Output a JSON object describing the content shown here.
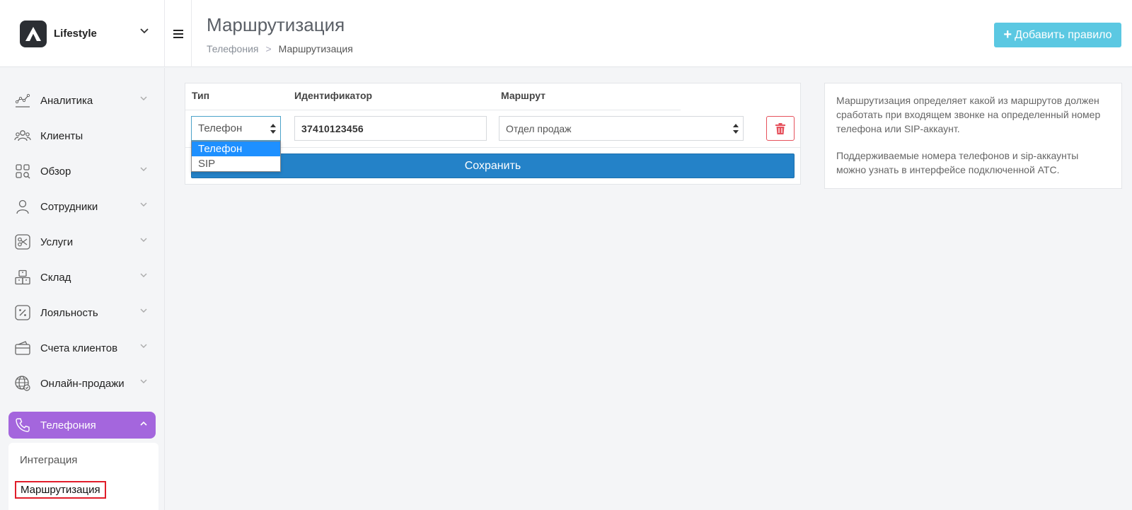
{
  "brand": {
    "name": "Lifestyle"
  },
  "header": {
    "title": "Маршрутизация",
    "breadcrumb": {
      "parent": "Телефония",
      "separator": ">",
      "current": "Маршрутизация"
    },
    "add_button_label": "Добавить правило",
    "add_button_color": "#5bc8e2"
  },
  "sidebar": {
    "items": [
      {
        "label": "Аналитика",
        "icon": "analytics-icon"
      },
      {
        "label": "Клиенты",
        "icon": "clients-icon"
      },
      {
        "label": "Обзор",
        "icon": "overview-icon"
      },
      {
        "label": "Сотрудники",
        "icon": "employee-icon"
      },
      {
        "label": "Услуги",
        "icon": "scissors-icon"
      },
      {
        "label": "Склад",
        "icon": "warehouse-icon"
      },
      {
        "label": "Лояльность",
        "icon": "percent-icon"
      },
      {
        "label": "Счета клиентов",
        "icon": "wallet-icon"
      },
      {
        "label": "Онлайн-продажи",
        "icon": "globe-icon"
      },
      {
        "label": "Телефония",
        "icon": "phone-icon",
        "active": true
      }
    ],
    "active_color": "#a466dd",
    "submenu": [
      {
        "label": "Интеграция"
      },
      {
        "label": "Маршрутизация",
        "selected": true
      }
    ]
  },
  "table": {
    "headers": {
      "type": "Тип",
      "identifier": "Идентификатор",
      "route": "Маршрут"
    },
    "row": {
      "type_value": "Телефон",
      "identifier_value": "37410123456",
      "route_value": "Отдел продаж"
    },
    "type_options": [
      "Телефон",
      "SIP"
    ],
    "save_label": "Сохранить",
    "save_color": "#2482c8"
  },
  "info": {
    "paragraph1": "Маршрутизация определяет какой из маршрутов должен сработать при входящем звонке на определенный номер телефона или SIP-аккаунт.",
    "paragraph2": "Поддерживаемые номера телефонов и sip-аккаунты можно узнать в интерфейсе подключенной АТС."
  }
}
